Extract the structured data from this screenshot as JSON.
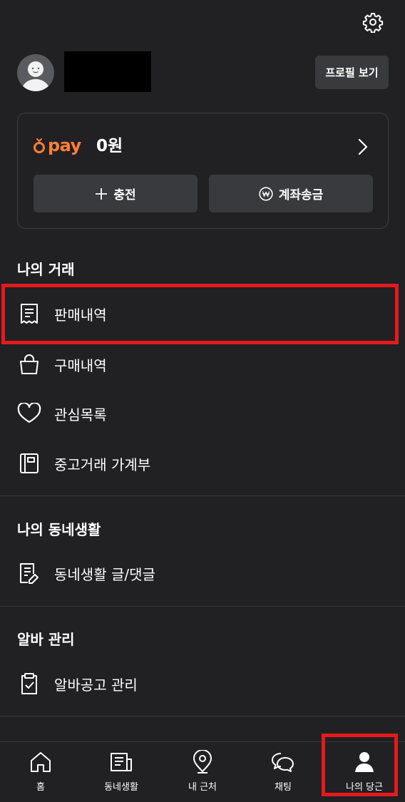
{
  "header": {
    "settings_icon": "gear-icon"
  },
  "profile": {
    "avatar_icon": "avatar-placeholder",
    "name_redacted": true,
    "profile_button": "프로필 보기"
  },
  "pay": {
    "brand": "pay",
    "balance": "0원",
    "charge_label": "충전",
    "transfer_label": "계좌송금",
    "accent": "#ff7e36"
  },
  "sections": {
    "trade": {
      "title": "나의 거래",
      "items": [
        "판매내역",
        "구매내역",
        "관심목록",
        "중고거래 가계부"
      ]
    },
    "community": {
      "title": "나의 동네생활",
      "items": [
        "동네생활 글/댓글"
      ]
    },
    "jobs": {
      "title": "알바 관리",
      "items": [
        "알바공고 관리"
      ]
    }
  },
  "tabs": [
    "홈",
    "동네생활",
    "내 근처",
    "채팅",
    "나의 당근"
  ],
  "colors": {
    "background": "#212124",
    "button": "#393a3e",
    "highlight": "#e6191c"
  }
}
